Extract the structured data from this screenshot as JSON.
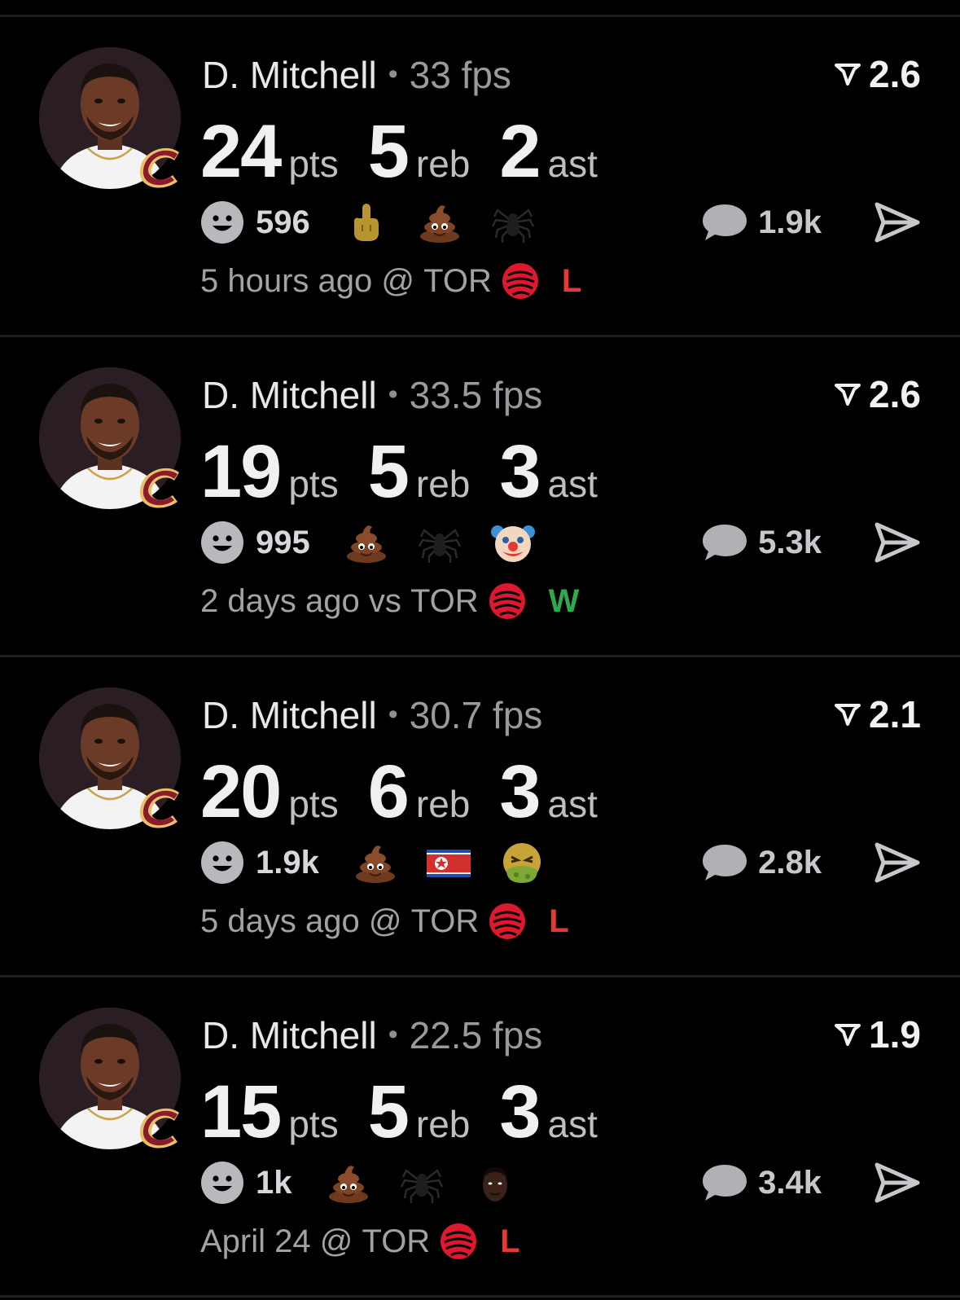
{
  "colors": {
    "background": "#000000",
    "loss": "#e53935",
    "win": "#2eaa4e",
    "muted": "#9a9a9e"
  },
  "icons": {
    "rating": "fantasy-rating-icon",
    "reaction": "smiley-icon",
    "comments": "chat-bubble-icon",
    "share": "send-icon",
    "team": "cavaliers-logo",
    "opponent": "raptors-logo"
  },
  "cards": [
    {
      "player": "D. Mitchell",
      "fps": "33 fps",
      "rating": "2.6",
      "pts": "24",
      "pts_label": "pts",
      "reb": "5",
      "reb_label": "reb",
      "ast": "2",
      "ast_label": "ast",
      "reactions_count": "596",
      "emojis": [
        "middle-finger-emoji",
        "poop-emoji",
        "spider-emoji"
      ],
      "comments": "1.9k",
      "time": "5 hours ago",
      "venue": "@",
      "opponent": "TOR",
      "result": "L"
    },
    {
      "player": "D. Mitchell",
      "fps": "33.5 fps",
      "rating": "2.6",
      "pts": "19",
      "pts_label": "pts",
      "reb": "5",
      "reb_label": "reb",
      "ast": "3",
      "ast_label": "ast",
      "reactions_count": "995",
      "emojis": [
        "poop-emoji",
        "spider-emoji",
        "clown-emoji"
      ],
      "comments": "5.3k",
      "time": "2 days ago",
      "venue": "vs",
      "opponent": "TOR",
      "result": "W"
    },
    {
      "player": "D. Mitchell",
      "fps": "30.7 fps",
      "rating": "2.1",
      "pts": "20",
      "pts_label": "pts",
      "reb": "6",
      "reb_label": "reb",
      "ast": "3",
      "ast_label": "ast",
      "reactions_count": "1.9k",
      "emojis": [
        "poop-emoji",
        "north-korea-flag-emoji",
        "nauseated-face-emoji"
      ],
      "comments": "2.8k",
      "time": "5 days ago",
      "venue": "@",
      "opponent": "TOR",
      "result": "L"
    },
    {
      "player": "D. Mitchell",
      "fps": "22.5 fps",
      "rating": "1.9",
      "pts": "15",
      "pts_label": "pts",
      "reb": "5",
      "reb_label": "reb",
      "ast": "3",
      "ast_label": "ast",
      "reactions_count": "1k",
      "emojis": [
        "poop-emoji",
        "spider-emoji",
        "player-face-emoji"
      ],
      "comments": "3.4k",
      "time": "April 24",
      "venue": "@",
      "opponent": "TOR",
      "result": "L"
    }
  ]
}
